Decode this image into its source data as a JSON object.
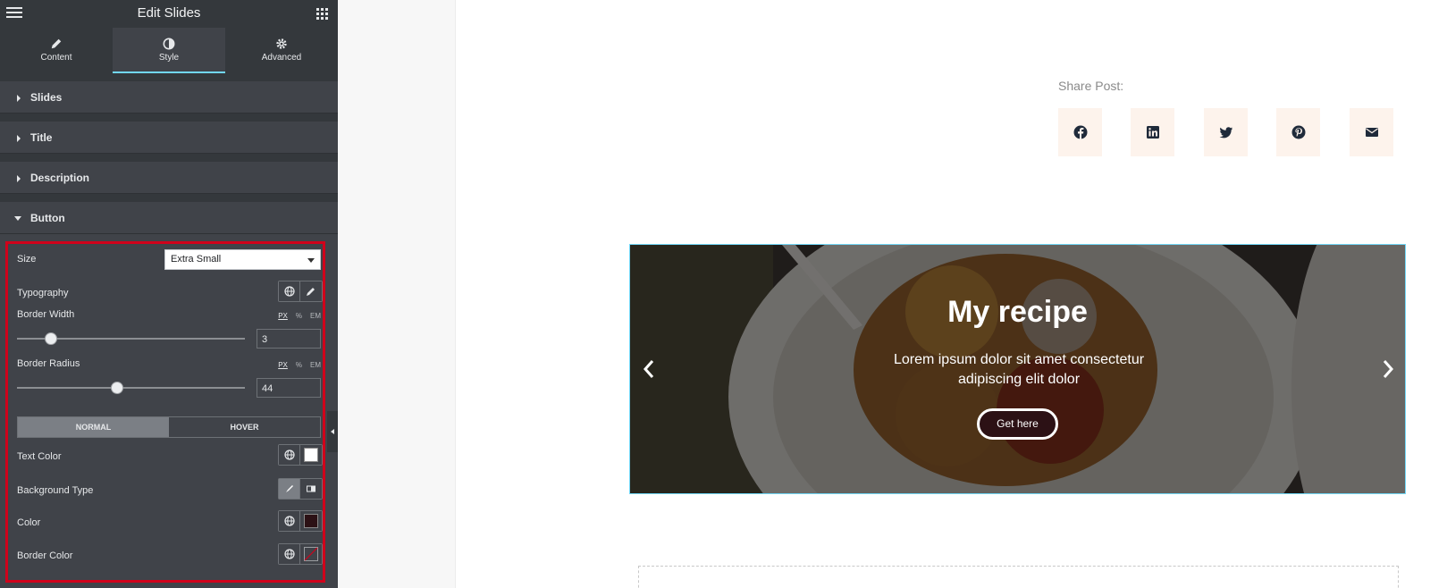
{
  "panel": {
    "title": "Edit Slides",
    "tabs": [
      {
        "label": "Content",
        "icon": "pencil-icon"
      },
      {
        "label": "Style",
        "icon": "half-circle-icon"
      },
      {
        "label": "Advanced",
        "icon": "gear-icon"
      }
    ],
    "sections": [
      "Slides",
      "Title",
      "Description",
      "Button"
    ],
    "button_controls": {
      "size": {
        "label": "Size",
        "value": "Extra Small"
      },
      "typography": {
        "label": "Typography"
      },
      "border_width": {
        "label": "Border Width",
        "units": [
          "PX",
          "%",
          "EM"
        ],
        "value": "3",
        "slider_fraction": 0.15
      },
      "border_radius": {
        "label": "Border Radius",
        "units": [
          "PX",
          "%",
          "EM"
        ],
        "value": "44",
        "slider_fraction": 0.44
      },
      "state_tabs": [
        "NORMAL",
        "HOVER"
      ],
      "text_color": {
        "label": "Text Color",
        "swatch": "#ffffff"
      },
      "background_type": {
        "label": "Background Type"
      },
      "color": {
        "label": "Color",
        "swatch": "#2c1115"
      },
      "border_color": {
        "label": "Border Color"
      }
    },
    "highlight_color": "#d0021b",
    "accent_color": "#71d7f7"
  },
  "preview": {
    "share_label": "Share Post:",
    "share_buttons": [
      "facebook-icon",
      "linkedin-icon",
      "twitter-icon",
      "pinterest-icon",
      "envelope-icon"
    ],
    "slide": {
      "title": "My recipe",
      "description": "Lorem ipsum dolor sit amet consectetur adipiscing elit dolor",
      "button": "Get here"
    }
  }
}
